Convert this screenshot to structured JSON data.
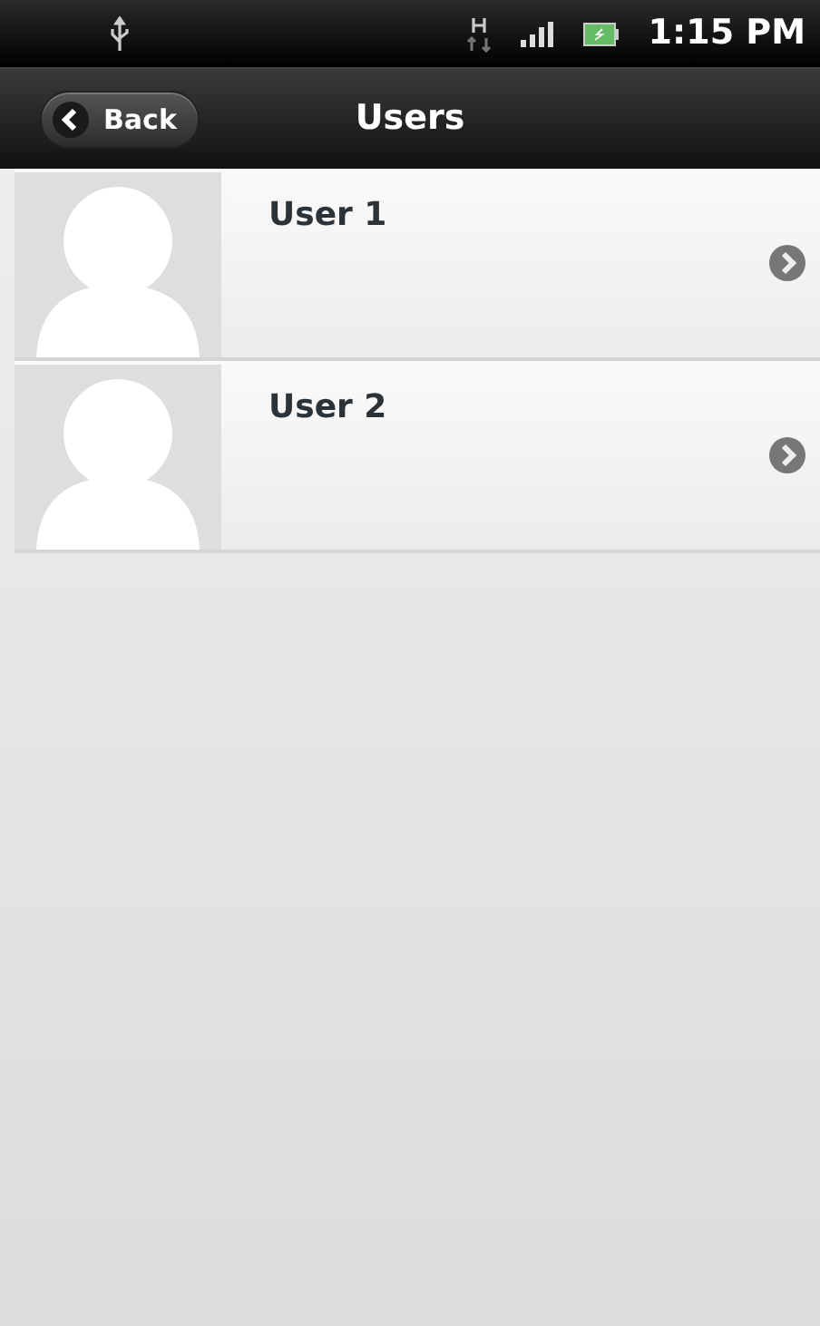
{
  "status_bar": {
    "time": "1:15 PM"
  },
  "header": {
    "back_label": "Back",
    "title": "Users"
  },
  "users": [
    {
      "name": "User 1"
    },
    {
      "name": "User 2"
    }
  ]
}
